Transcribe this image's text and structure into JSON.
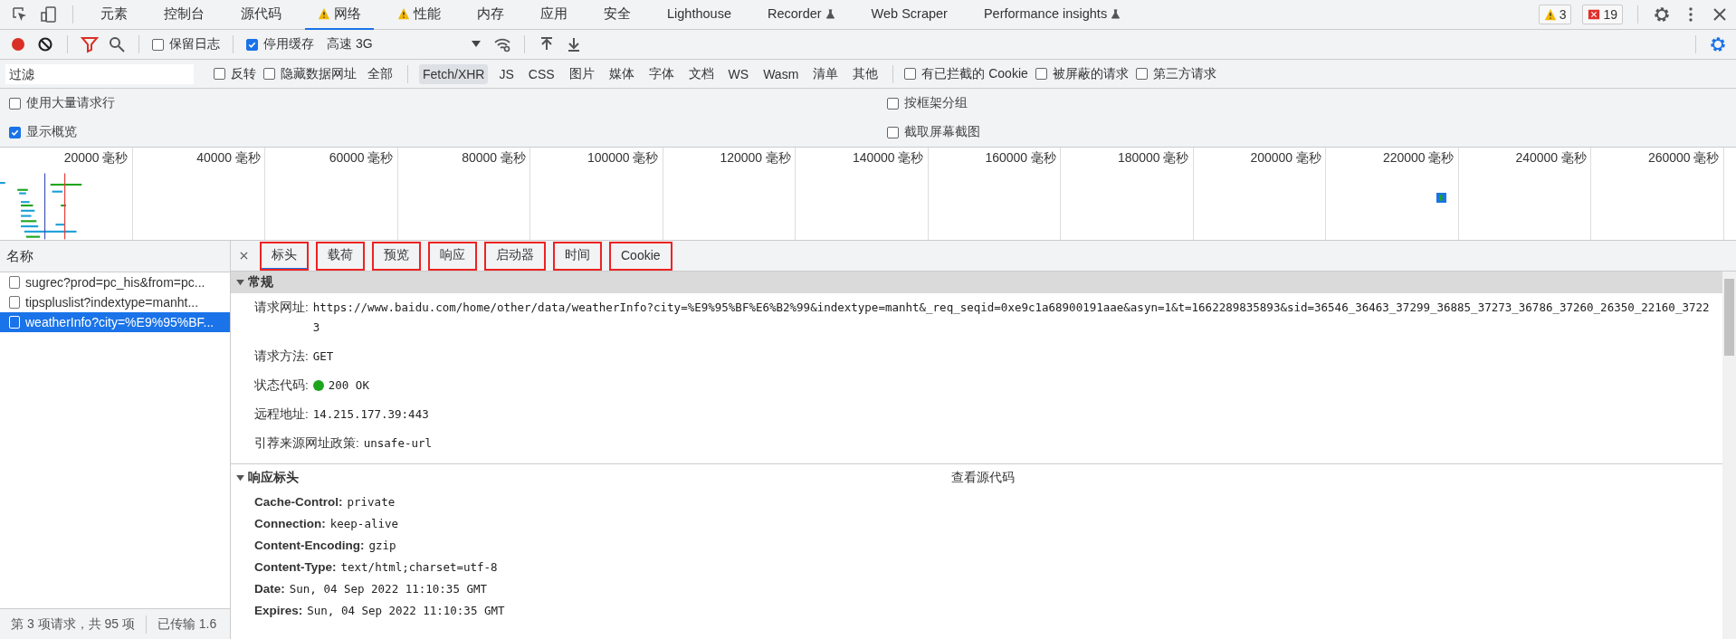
{
  "top_tabs": [
    {
      "label": "元素",
      "selected": false,
      "warning": false,
      "experimental": false
    },
    {
      "label": "控制台",
      "selected": false,
      "warning": false,
      "experimental": false
    },
    {
      "label": "源代码",
      "selected": false,
      "warning": false,
      "experimental": false
    },
    {
      "label": "网络",
      "selected": true,
      "warning": true,
      "experimental": false
    },
    {
      "label": "性能",
      "selected": false,
      "warning": true,
      "experimental": false
    },
    {
      "label": "内存",
      "selected": false,
      "warning": false,
      "experimental": false
    },
    {
      "label": "应用",
      "selected": false,
      "warning": false,
      "experimental": false
    },
    {
      "label": "安全",
      "selected": false,
      "warning": false,
      "experimental": false
    },
    {
      "label": "Lighthouse",
      "selected": false,
      "warning": false,
      "experimental": false
    },
    {
      "label": "Recorder",
      "selected": false,
      "warning": false,
      "experimental": true
    },
    {
      "label": "Web Scraper",
      "selected": false,
      "warning": false,
      "experimental": false
    },
    {
      "label": "Performance insights",
      "selected": false,
      "warning": false,
      "experimental": true
    }
  ],
  "issue_counts": {
    "warnings": "3",
    "errors": "19"
  },
  "toolbar": {
    "preserve_log": {
      "label": "保留日志",
      "checked": false
    },
    "disable_cache": {
      "label": "停用缓存",
      "checked": true
    },
    "throttling": "高速 3G"
  },
  "filter": {
    "placeholder": "过滤",
    "options_before": [
      {
        "label": "反转",
        "checked": false
      },
      {
        "label": "隐藏数据网址",
        "checked": false
      }
    ],
    "types": [
      {
        "label": "全部",
        "selected": false
      },
      {
        "label": "Fetch/XHR",
        "selected": true
      },
      {
        "label": "JS",
        "selected": false
      },
      {
        "label": "CSS",
        "selected": false
      },
      {
        "label": "图片",
        "selected": false
      },
      {
        "label": "媒体",
        "selected": false
      },
      {
        "label": "字体",
        "selected": false
      },
      {
        "label": "文档",
        "selected": false
      },
      {
        "label": "WS",
        "selected": false
      },
      {
        "label": "Wasm",
        "selected": false
      },
      {
        "label": "清单",
        "selected": false
      },
      {
        "label": "其他",
        "selected": false
      }
    ],
    "options_after": [
      {
        "label": "有已拦截的 Cookie",
        "checked": false
      },
      {
        "label": "被屏蔽的请求",
        "checked": false
      },
      {
        "label": "第三方请求",
        "checked": false
      }
    ]
  },
  "settings": [
    {
      "label": "使用大量请求行",
      "checked": false
    },
    {
      "label": "按框架分组",
      "checked": false
    },
    {
      "label": "显示概览",
      "checked": true
    },
    {
      "label": "截取屏幕截图",
      "checked": false
    }
  ],
  "timeline": {
    "ticks": [
      "20000 毫秒",
      "40000 毫秒",
      "60000 毫秒",
      "80000 毫秒",
      "100000 毫秒",
      "120000 毫秒",
      "140000 毫秒",
      "160000 毫秒",
      "180000 毫秒",
      "200000 毫秒",
      "220000 毫秒",
      "240000 毫秒",
      "260000 毫秒"
    ]
  },
  "requests": {
    "column": "名称",
    "rows": [
      {
        "name": "sugrec?prod=pc_his&from=pc...",
        "selected": false
      },
      {
        "name": "tipspluslist?indextype=manht...",
        "selected": false
      },
      {
        "name": "weatherInfo?city=%E9%95%BF...",
        "selected": true
      }
    ]
  },
  "status_bar": [
    "第 3 项请求，共 95 项",
    "已传输 1.6"
  ],
  "detail_tabs": [
    {
      "label": "标头",
      "selected": true,
      "highlighted": true
    },
    {
      "label": "载荷",
      "selected": false,
      "highlighted": true
    },
    {
      "label": "预览",
      "selected": false,
      "highlighted": true
    },
    {
      "label": "响应",
      "selected": false,
      "highlighted": true
    },
    {
      "label": "启动器",
      "selected": false,
      "highlighted": true
    },
    {
      "label": "时间",
      "selected": false,
      "highlighted": true
    },
    {
      "label": "Cookie",
      "selected": false,
      "highlighted": true
    }
  ],
  "general": {
    "title": "常规",
    "expanded": true,
    "rows": [
      {
        "key": "请求网址:",
        "value": "https://www.baidu.com/home/other/data/weatherInfo?city=%E9%95%BF%E6%B2%99&indextype=manht&_req_seqid=0xe9c1a68900191aae&asyn=1&t=1662289835893&sid=36546_36463_37299_36885_37273_36786_37260_26350_22160_37223",
        "kind": "text"
      },
      {
        "key": "请求方法:",
        "value": "GET",
        "kind": "text"
      },
      {
        "key": "状态代码:",
        "value": "200 OK",
        "kind": "status",
        "color": "#1ea51e"
      },
      {
        "key": "远程地址:",
        "value": "14.215.177.39:443",
        "kind": "text"
      },
      {
        "key": "引荐来源网址政策:",
        "value": "unsafe-url",
        "kind": "text"
      }
    ]
  },
  "response_headers": {
    "title": "响应标头",
    "expanded": true,
    "view_source": "查看源代码",
    "rows": [
      {
        "key": "Cache-Control:",
        "value": "private"
      },
      {
        "key": "Connection:",
        "value": "keep-alive"
      },
      {
        "key": "Content-Encoding:",
        "value": "gzip"
      },
      {
        "key": "Content-Type:",
        "value": "text/html;charset=utf-8"
      },
      {
        "key": "Date:",
        "value": "Sun, 04 Sep 2022 11:10:35 GMT"
      },
      {
        "key": "Expires:",
        "value": "Sun, 04 Sep 2022 11:10:35 GMT"
      }
    ]
  }
}
